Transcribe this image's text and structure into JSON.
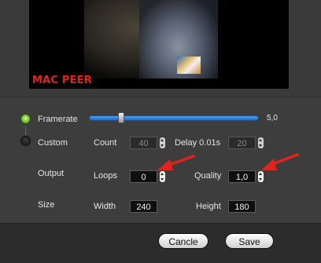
{
  "preview": {
    "brand_text": "MAC PEER"
  },
  "mode": {
    "framerate_label": "Framerate",
    "custom_label": "Custom",
    "selected": "Framerate"
  },
  "framerate": {
    "value_text": "5,0",
    "slider_fraction": 0.18
  },
  "custom": {
    "count_label": "Count",
    "count_value": "40",
    "delay_label": "Delay 0.01s",
    "delay_value": "20"
  },
  "output": {
    "section_label": "Output",
    "loops_label": "Loops",
    "loops_value": "0",
    "quality_label": "Quality",
    "quality_value": "1,0"
  },
  "size": {
    "section_label": "Size",
    "width_label": "Width",
    "width_value": "240",
    "height_label": "Height",
    "height_value": "180"
  },
  "buttons": {
    "cancel_label": "Cancle",
    "save_label": "Save"
  },
  "colors": {
    "accent_slider": "#2d7fe0",
    "annotation_arrow": "#e0241b",
    "brand_red": "#e1261c"
  },
  "annotations": {
    "arrow_count": 2
  }
}
